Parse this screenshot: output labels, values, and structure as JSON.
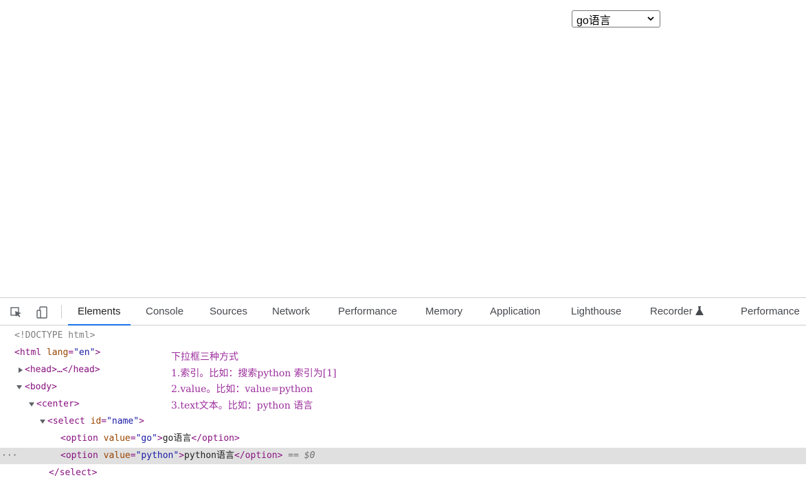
{
  "page": {
    "select_value": "go语言"
  },
  "devtools": {
    "tabs": [
      "Elements",
      "Console",
      "Sources",
      "Network",
      "Performance",
      "Memory",
      "Application",
      "Lighthouse",
      "Recorder",
      "Performance"
    ],
    "active_tab": "Elements",
    "dom": {
      "doctype": "<!DOCTYPE html>",
      "html_tag": "<html",
      "html_attr": "lang",
      "html_val": "\"en\"",
      "head_collapsed": "<head>…</head>",
      "body_open": "<body>",
      "center_open": "<center>",
      "select_open": "<select",
      "select_attr": "id",
      "select_val": "\"name\"",
      "option_open": "<option",
      "option_attr": "value",
      "option1_val": "\"go\"",
      "option1_text": "go语言",
      "option2_val": "\"python\"",
      "option2_text": "python语言",
      "option_close": "</option>",
      "selected_marker": "== $0",
      "select_close": "</select>"
    }
  },
  "annotation": {
    "line1": "下拉框三种方式",
    "line2": "1.索引。比如：搜索python 索引为[1]",
    "line3": "2.value。比如：value=python",
    "line4": "3.text文本。比如：python 语言"
  },
  "colors": {
    "tag": "#881280",
    "attr": "#994500",
    "attr_value": "#1a1aa6",
    "annotation": "#9c2e9c",
    "active_tab_underline": "#1a73e8",
    "selected_row": "#e0e0e0"
  }
}
